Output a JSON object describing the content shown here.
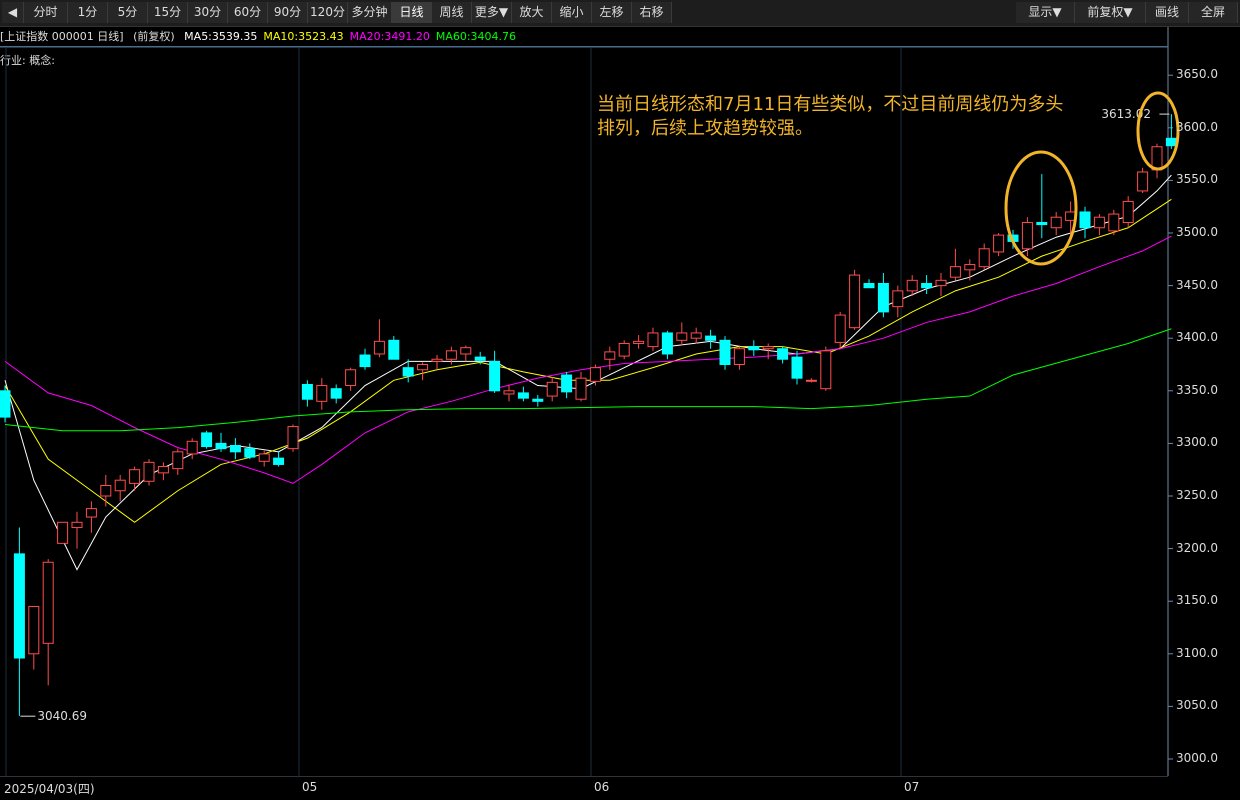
{
  "toolbar": {
    "left": [
      {
        "id": "prev",
        "label": "◀"
      },
      {
        "id": "fenshi",
        "label": "分时"
      },
      {
        "id": "1m",
        "label": "1分"
      },
      {
        "id": "5m",
        "label": "5分"
      },
      {
        "id": "15m",
        "label": "15分"
      },
      {
        "id": "30m",
        "label": "30分"
      },
      {
        "id": "60m",
        "label": "60分"
      },
      {
        "id": "90m",
        "label": "90分"
      },
      {
        "id": "120m",
        "label": "120分"
      },
      {
        "id": "multi",
        "label": "多分钟"
      },
      {
        "id": "day",
        "label": "日线",
        "active": true
      },
      {
        "id": "week",
        "label": "周线"
      },
      {
        "id": "more",
        "label": "更多▼"
      },
      {
        "id": "zoomin",
        "label": "放大"
      },
      {
        "id": "zoomout",
        "label": "缩小"
      },
      {
        "id": "left",
        "label": "左移"
      },
      {
        "id": "right",
        "label": "右移"
      }
    ],
    "right": [
      {
        "id": "display",
        "label": "显示▼"
      },
      {
        "id": "adjust",
        "label": "前复权▼"
      },
      {
        "id": "draw",
        "label": "画线"
      },
      {
        "id": "fullscreen",
        "label": "全屏"
      }
    ]
  },
  "info": {
    "security": "[上证指数 000001 日线]",
    "adjust": "(前复权)",
    "ma": [
      {
        "label": "MA5:3539.35",
        "color": "#ffffff"
      },
      {
        "label": "MA10:3523.43",
        "color": "#ffff00"
      },
      {
        "label": "MA20:3491.20",
        "color": "#ff00ff"
      },
      {
        "label": "MA60:3404.76",
        "color": "#00ff00"
      }
    ]
  },
  "industry_label": "行业: 概念:",
  "annotation": "当前日线形态和7月11日有些类似，不过目前周线仍为多头排列，后续上攻趋势较强。",
  "colors": {
    "up": "#ff4d4d",
    "down": "#00ffff",
    "ma5": "#ffffff",
    "ma10": "#ffff00",
    "ma20": "#ff00ff",
    "ma60": "#00ff00",
    "highlight": "#f2b429"
  },
  "date_axis": {
    "first": "2025/04/03(四)",
    "month_labels": [
      "05",
      "06",
      "07"
    ]
  },
  "chart_data": {
    "type": "candlestick",
    "y_ticks": [
      "3650.0",
      "3600.0",
      "3550.0",
      "3500.0",
      "3450.0",
      "3400.0",
      "3350.0",
      "3300.0",
      "3250.0",
      "3200.0",
      "3150.0",
      "3100.0",
      "3050.0",
      "3000.0"
    ],
    "ylim": [
      3000,
      3650
    ],
    "max_label": "3613.02",
    "min_label": "3040.69",
    "candles": [
      {
        "o": 3350,
        "h": 3355,
        "l": 3320,
        "c": 3325
      },
      {
        "o": 3195,
        "h": 3220,
        "l": 3041,
        "c": 3096
      },
      {
        "o": 3100,
        "h": 3145,
        "l": 3085,
        "c": 3145
      },
      {
        "o": 3110,
        "h": 3190,
        "l": 3070,
        "c": 3187
      },
      {
        "o": 3205,
        "h": 3225,
        "l": 3205,
        "c": 3225
      },
      {
        "o": 3220,
        "h": 3235,
        "l": 3200,
        "c": 3225
      },
      {
        "o": 3230,
        "h": 3245,
        "l": 3215,
        "c": 3238
      },
      {
        "o": 3250,
        "h": 3270,
        "l": 3240,
        "c": 3260
      },
      {
        "o": 3255,
        "h": 3270,
        "l": 3245,
        "c": 3265
      },
      {
        "o": 3262,
        "h": 3278,
        "l": 3255,
        "c": 3275
      },
      {
        "o": 3264,
        "h": 3285,
        "l": 3260,
        "c": 3282
      },
      {
        "o": 3272,
        "h": 3282,
        "l": 3265,
        "c": 3278
      },
      {
        "o": 3276,
        "h": 3295,
        "l": 3270,
        "c": 3292
      },
      {
        "o": 3290,
        "h": 3305,
        "l": 3285,
        "c": 3302
      },
      {
        "o": 3310,
        "h": 3312,
        "l": 3295,
        "c": 3297
      },
      {
        "o": 3300,
        "h": 3310,
        "l": 3292,
        "c": 3295
      },
      {
        "o": 3298,
        "h": 3305,
        "l": 3285,
        "c": 3292
      },
      {
        "o": 3295,
        "h": 3300,
        "l": 3285,
        "c": 3287
      },
      {
        "o": 3283,
        "h": 3293,
        "l": 3278,
        "c": 3290
      },
      {
        "o": 3286,
        "h": 3293,
        "l": 3278,
        "c": 3280
      },
      {
        "o": 3295,
        "h": 3318,
        "l": 3292,
        "c": 3316
      },
      {
        "o": 3356,
        "h": 3360,
        "l": 3335,
        "c": 3342
      },
      {
        "o": 3340,
        "h": 3362,
        "l": 3332,
        "c": 3355
      },
      {
        "o": 3352,
        "h": 3356,
        "l": 3338,
        "c": 3343
      },
      {
        "o": 3355,
        "h": 3372,
        "l": 3350,
        "c": 3370
      },
      {
        "o": 3384,
        "h": 3390,
        "l": 3370,
        "c": 3373
      },
      {
        "o": 3385,
        "h": 3418,
        "l": 3382,
        "c": 3397
      },
      {
        "o": 3398,
        "h": 3402,
        "l": 3380,
        "c": 3380
      },
      {
        "o": 3372,
        "h": 3380,
        "l": 3358,
        "c": 3364
      },
      {
        "o": 3370,
        "h": 3377,
        "l": 3360,
        "c": 3375
      },
      {
        "o": 3378,
        "h": 3384,
        "l": 3370,
        "c": 3380
      },
      {
        "o": 3380,
        "h": 3392,
        "l": 3375,
        "c": 3388
      },
      {
        "o": 3385,
        "h": 3393,
        "l": 3378,
        "c": 3391
      },
      {
        "o": 3382,
        "h": 3387,
        "l": 3375,
        "c": 3379
      },
      {
        "o": 3378,
        "h": 3388,
        "l": 3348,
        "c": 3350
      },
      {
        "o": 3347,
        "h": 3356,
        "l": 3340,
        "c": 3350
      },
      {
        "o": 3348,
        "h": 3354,
        "l": 3340,
        "c": 3343
      },
      {
        "o": 3342,
        "h": 3346,
        "l": 3335,
        "c": 3340
      },
      {
        "o": 3345,
        "h": 3363,
        "l": 3340,
        "c": 3358
      },
      {
        "o": 3365,
        "h": 3368,
        "l": 3343,
        "c": 3349
      },
      {
        "o": 3342,
        "h": 3368,
        "l": 3340,
        "c": 3362
      },
      {
        "o": 3359,
        "h": 3375,
        "l": 3355,
        "c": 3372
      },
      {
        "o": 3380,
        "h": 3392,
        "l": 3370,
        "c": 3387
      },
      {
        "o": 3383,
        "h": 3398,
        "l": 3380,
        "c": 3395
      },
      {
        "o": 3395,
        "h": 3403,
        "l": 3390,
        "c": 3397
      },
      {
        "o": 3392,
        "h": 3410,
        "l": 3388,
        "c": 3405
      },
      {
        "o": 3405,
        "h": 3407,
        "l": 3380,
        "c": 3385
      },
      {
        "o": 3398,
        "h": 3415,
        "l": 3393,
        "c": 3405
      },
      {
        "o": 3400,
        "h": 3410,
        "l": 3395,
        "c": 3405
      },
      {
        "o": 3402,
        "h": 3408,
        "l": 3390,
        "c": 3398
      },
      {
        "o": 3398,
        "h": 3402,
        "l": 3370,
        "c": 3375
      },
      {
        "o": 3375,
        "h": 3392,
        "l": 3370,
        "c": 3390
      },
      {
        "o": 3392,
        "h": 3398,
        "l": 3383,
        "c": 3389
      },
      {
        "o": 3390,
        "h": 3395,
        "l": 3380,
        "c": 3392
      },
      {
        "o": 3390,
        "h": 3392,
        "l": 3376,
        "c": 3380
      },
      {
        "o": 3382,
        "h": 3388,
        "l": 3356,
        "c": 3362
      },
      {
        "o": 3360,
        "h": 3362,
        "l": 3358,
        "c": 3360
      },
      {
        "o": 3352,
        "h": 3392,
        "l": 3350,
        "c": 3388
      },
      {
        "o": 3396,
        "h": 3425,
        "l": 3390,
        "c": 3422
      },
      {
        "o": 3410,
        "h": 3465,
        "l": 3408,
        "c": 3460
      },
      {
        "o": 3452,
        "h": 3456,
        "l": 3448,
        "c": 3448
      },
      {
        "o": 3452,
        "h": 3462,
        "l": 3420,
        "c": 3425
      },
      {
        "o": 3430,
        "h": 3450,
        "l": 3420,
        "c": 3445
      },
      {
        "o": 3445,
        "h": 3460,
        "l": 3440,
        "c": 3455
      },
      {
        "o": 3452,
        "h": 3460,
        "l": 3442,
        "c": 3448
      },
      {
        "o": 3450,
        "h": 3462,
        "l": 3440,
        "c": 3455
      },
      {
        "o": 3458,
        "h": 3485,
        "l": 3455,
        "c": 3468
      },
      {
        "o": 3465,
        "h": 3475,
        "l": 3455,
        "c": 3470
      },
      {
        "o": 3468,
        "h": 3490,
        "l": 3465,
        "c": 3485
      },
      {
        "o": 3482,
        "h": 3500,
        "l": 3478,
        "c": 3498
      },
      {
        "o": 3498,
        "h": 3503,
        "l": 3485,
        "c": 3492
      },
      {
        "o": 3485,
        "h": 3515,
        "l": 3478,
        "c": 3510
      },
      {
        "o": 3510,
        "h": 3556,
        "l": 3495,
        "c": 3508
      },
      {
        "o": 3505,
        "h": 3520,
        "l": 3498,
        "c": 3515
      },
      {
        "o": 3512,
        "h": 3530,
        "l": 3498,
        "c": 3520
      },
      {
        "o": 3520,
        "h": 3525,
        "l": 3495,
        "c": 3505
      },
      {
        "o": 3505,
        "h": 3518,
        "l": 3498,
        "c": 3515
      },
      {
        "o": 3502,
        "h": 3522,
        "l": 3498,
        "c": 3518
      },
      {
        "o": 3510,
        "h": 3535,
        "l": 3505,
        "c": 3530
      },
      {
        "o": 3540,
        "h": 3562,
        "l": 3538,
        "c": 3558
      },
      {
        "o": 3560,
        "h": 3585,
        "l": 3552,
        "c": 3582
      },
      {
        "o": 3590,
        "h": 3613,
        "l": 3580,
        "c": 3583
      }
    ],
    "ma": [
      {
        "name": "MA5",
        "points": [
          [
            0,
            3360
          ],
          [
            2,
            3265
          ],
          [
            5,
            3180
          ],
          [
            7,
            3230
          ],
          [
            10,
            3270
          ],
          [
            13,
            3290
          ],
          [
            16,
            3298
          ],
          [
            19,
            3292
          ],
          [
            22,
            3315
          ],
          [
            25,
            3355
          ],
          [
            28,
            3378
          ],
          [
            31,
            3378
          ],
          [
            34,
            3378
          ],
          [
            37,
            3355
          ],
          [
            40,
            3352
          ],
          [
            43,
            3372
          ],
          [
            46,
            3392
          ],
          [
            49,
            3397
          ],
          [
            52,
            3390
          ],
          [
            55,
            3385
          ],
          [
            58,
            3390
          ],
          [
            61,
            3430
          ],
          [
            64,
            3447
          ],
          [
            67,
            3458
          ],
          [
            70,
            3478
          ],
          [
            73,
            3496
          ],
          [
            76,
            3508
          ],
          [
            78,
            3516
          ],
          [
            80,
            3540
          ],
          [
            81,
            3555
          ]
        ]
      },
      {
        "name": "MA10",
        "points": [
          [
            0,
            3355
          ],
          [
            3,
            3285
          ],
          [
            6,
            3255
          ],
          [
            9,
            3225
          ],
          [
            12,
            3255
          ],
          [
            15,
            3280
          ],
          [
            18,
            3290
          ],
          [
            21,
            3305
          ],
          [
            24,
            3330
          ],
          [
            27,
            3360
          ],
          [
            30,
            3370
          ],
          [
            33,
            3377
          ],
          [
            36,
            3368
          ],
          [
            39,
            3360
          ],
          [
            42,
            3360
          ],
          [
            45,
            3372
          ],
          [
            48,
            3385
          ],
          [
            51,
            3392
          ],
          [
            54,
            3392
          ],
          [
            57,
            3385
          ],
          [
            60,
            3402
          ],
          [
            63,
            3425
          ],
          [
            66,
            3445
          ],
          [
            69,
            3458
          ],
          [
            72,
            3478
          ],
          [
            75,
            3492
          ],
          [
            78,
            3505
          ],
          [
            81,
            3532
          ]
        ]
      },
      {
        "name": "MA20",
        "points": [
          [
            0,
            3378
          ],
          [
            3,
            3348
          ],
          [
            6,
            3336
          ],
          [
            9,
            3315
          ],
          [
            12,
            3296
          ],
          [
            15,
            3285
          ],
          [
            18,
            3272
          ],
          [
            20,
            3262
          ],
          [
            22,
            3280
          ],
          [
            25,
            3310
          ],
          [
            28,
            3330
          ],
          [
            31,
            3340
          ],
          [
            34,
            3352
          ],
          [
            37,
            3362
          ],
          [
            40,
            3370
          ],
          [
            43,
            3376
          ],
          [
            46,
            3378
          ],
          [
            49,
            3380
          ],
          [
            52,
            3382
          ],
          [
            55,
            3385
          ],
          [
            58,
            3390
          ],
          [
            61,
            3400
          ],
          [
            64,
            3415
          ],
          [
            67,
            3425
          ],
          [
            70,
            3440
          ],
          [
            73,
            3452
          ],
          [
            76,
            3468
          ],
          [
            79,
            3483
          ],
          [
            81,
            3497
          ]
        ]
      },
      {
        "name": "MA60",
        "points": [
          [
            0,
            3318
          ],
          [
            4,
            3312
          ],
          [
            8,
            3312
          ],
          [
            12,
            3315
          ],
          [
            16,
            3320
          ],
          [
            20,
            3326
          ],
          [
            24,
            3330
          ],
          [
            28,
            3332
          ],
          [
            32,
            3333
          ],
          [
            36,
            3333
          ],
          [
            40,
            3334
          ],
          [
            44,
            3335
          ],
          [
            48,
            3335
          ],
          [
            52,
            3335
          ],
          [
            56,
            3333
          ],
          [
            60,
            3336
          ],
          [
            64,
            3342
          ],
          [
            67,
            3345
          ],
          [
            70,
            3365
          ],
          [
            74,
            3380
          ],
          [
            78,
            3395
          ],
          [
            81,
            3409
          ]
        ]
      }
    ]
  }
}
